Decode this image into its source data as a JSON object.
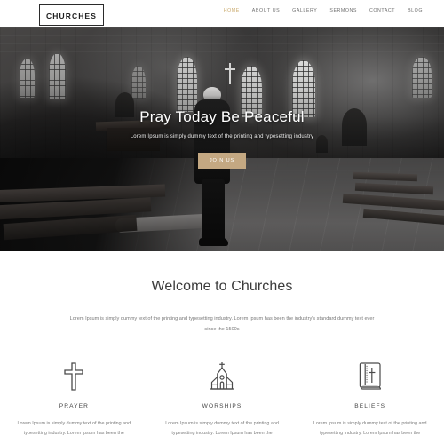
{
  "header": {
    "logo": "CHURCHES",
    "nav": [
      {
        "label": "HOME",
        "active": true
      },
      {
        "label": "ABOUT US",
        "active": false
      },
      {
        "label": "GALLERY",
        "active": false
      },
      {
        "label": "SERMONS",
        "active": false
      },
      {
        "label": "CONTACT",
        "active": false
      },
      {
        "label": "BLOG",
        "active": false
      }
    ]
  },
  "hero": {
    "title": "Pray Today Be Peaceful",
    "subtitle": "Lorem Ipsum is simply dummy text of the printing and typesetting industry",
    "button_label": "JOIN US",
    "image_alt": "church-interior-photo"
  },
  "welcome": {
    "title": "Welcome to Churches",
    "text": "Lorem Ipsum is simply dummy text of the printing and typesetting industry. Lorem Ipsum has been the industry's standard dummy text ever since the 1500s"
  },
  "features": [
    {
      "icon": "cross-icon",
      "title": "PRAYER",
      "text": "Lorem Ipsum is simply dummy text of the printing and typesetting industry. Lorem Ipsum has been the"
    },
    {
      "icon": "church-icon",
      "title": "WORSHIPS",
      "text": "Lorem Ipsum is simply dummy text of the printing and typesetting industry. Lorem Ipsum has been the"
    },
    {
      "icon": "bible-icon",
      "title": "BELIEFS",
      "text": "Lorem Ipsum is simply dummy text of the printing and typesetting industry. Lorem Ipsum has been the"
    }
  ],
  "colors": {
    "accent": "#c4a882",
    "nav_active": "#c9a86a",
    "heading": "#3b3b3b",
    "body_text": "#787878",
    "page_bg": "#ffffff"
  }
}
